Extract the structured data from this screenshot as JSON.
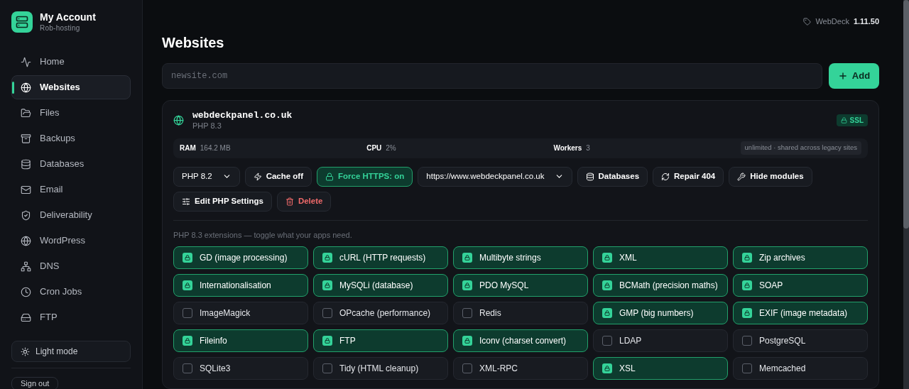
{
  "sidebar": {
    "account": {
      "title": "My Account",
      "subtitle": "Rob-hosting"
    },
    "items": [
      {
        "label": "Home",
        "selected": false
      },
      {
        "label": "Websites",
        "selected": true
      },
      {
        "label": "Files",
        "selected": false
      },
      {
        "label": "Backups",
        "selected": false
      },
      {
        "label": "Databases",
        "selected": false
      },
      {
        "label": "Email",
        "selected": false
      },
      {
        "label": "Deliverability",
        "selected": false
      },
      {
        "label": "WordPress",
        "selected": false
      },
      {
        "label": "DNS",
        "selected": false
      },
      {
        "label": "Cron Jobs",
        "selected": false
      },
      {
        "label": "FTP",
        "selected": false
      }
    ],
    "theme_toggle": "Light mode",
    "sign_out": "Sign out"
  },
  "version": {
    "product": "WebDeck",
    "number": "1.11.50"
  },
  "title": "Websites",
  "new_site": {
    "placeholder": "newsite.com"
  },
  "add_button": "Add",
  "site": {
    "domain": "webdeckpanel.co.uk",
    "php": "PHP 8.3",
    "badge": "SSL",
    "stats": [
      {
        "label": "RAM",
        "value": "164.2 MB"
      },
      {
        "label": "CPU",
        "value": "2%"
      },
      {
        "label": "Workers",
        "value": "3"
      }
    ],
    "stats_note": "unlimited · shared across legacy sites",
    "actions": [
      {
        "kind": "select",
        "label": "PHP 8.2"
      },
      {
        "kind": "button",
        "label": "Cache off"
      },
      {
        "kind": "toggle",
        "label": "Force HTTPS: on",
        "on": true
      },
      {
        "kind": "select",
        "label": "https://www.webdeckpanel.co.uk"
      },
      {
        "kind": "button",
        "label": "Databases"
      },
      {
        "kind": "button",
        "label": "Repair 404"
      },
      {
        "kind": "button",
        "label": "Hide modules"
      },
      {
        "kind": "button",
        "label": "Edit PHP Settings"
      },
      {
        "kind": "danger",
        "label": "Delete"
      }
    ],
    "extensions_note": "PHP 8.3 extensions — toggle what your apps need.",
    "extensions": [
      {
        "label": "GD (image processing)",
        "checked": true
      },
      {
        "label": "cURL (HTTP requests)",
        "checked": true
      },
      {
        "label": "Multibyte strings",
        "checked": true
      },
      {
        "label": "XML",
        "checked": true
      },
      {
        "label": "Zip archives",
        "checked": true
      },
      {
        "label": "Internationalisation",
        "checked": true
      },
      {
        "label": "MySQLi (database)",
        "checked": true
      },
      {
        "label": "PDO MySQL",
        "checked": true
      },
      {
        "label": "BCMath (precision maths)",
        "checked": true
      },
      {
        "label": "SOAP",
        "checked": true
      },
      {
        "label": "ImageMagick",
        "checked": false
      },
      {
        "label": "OPcache (performance)",
        "checked": false
      },
      {
        "label": "Redis",
        "checked": false
      },
      {
        "label": "GMP (big numbers)",
        "checked": true
      },
      {
        "label": "EXIF (image metadata)",
        "checked": true
      },
      {
        "label": "Fileinfo",
        "checked": true
      },
      {
        "label": "FTP",
        "checked": true
      },
      {
        "label": "Iconv (charset convert)",
        "checked": true
      },
      {
        "label": "LDAP",
        "checked": false
      },
      {
        "label": "PostgreSQL",
        "checked": false
      },
      {
        "label": "SQLite3",
        "checked": false
      },
      {
        "label": "Tidy (HTML cleanup)",
        "checked": false
      },
      {
        "label": "XML-RPC",
        "checked": false
      },
      {
        "label": "XSL",
        "checked": true
      },
      {
        "label": "Memcached",
        "checked": false
      }
    ]
  }
}
